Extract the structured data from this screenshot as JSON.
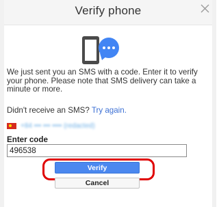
{
  "dialog": {
    "title": "Verify phone",
    "close_icon": "close-x-icon"
  },
  "illustration": {
    "icon": "phone-sms-icon",
    "phone_color": "#4a4a4a",
    "bubble_color": "#4285f4"
  },
  "message": "We just sent you an SMS with a code. Enter it to verify your phone. Please note that SMS delivery can take a minute or more.",
  "retry": {
    "prompt": "Didn't receive an SMS?",
    "link_label": "Try again."
  },
  "phone": {
    "flag_icon": "vietnam-flag-icon",
    "number_display": "+84 ••• ••• •••• (redacted)"
  },
  "code_field": {
    "label": "Enter code",
    "value": "496538"
  },
  "actions": {
    "verify_label": "Verify",
    "cancel_label": "Cancel"
  },
  "colors": {
    "accent": "#4b88ef",
    "link": "#3b6fd4",
    "highlight": "#e00000"
  }
}
